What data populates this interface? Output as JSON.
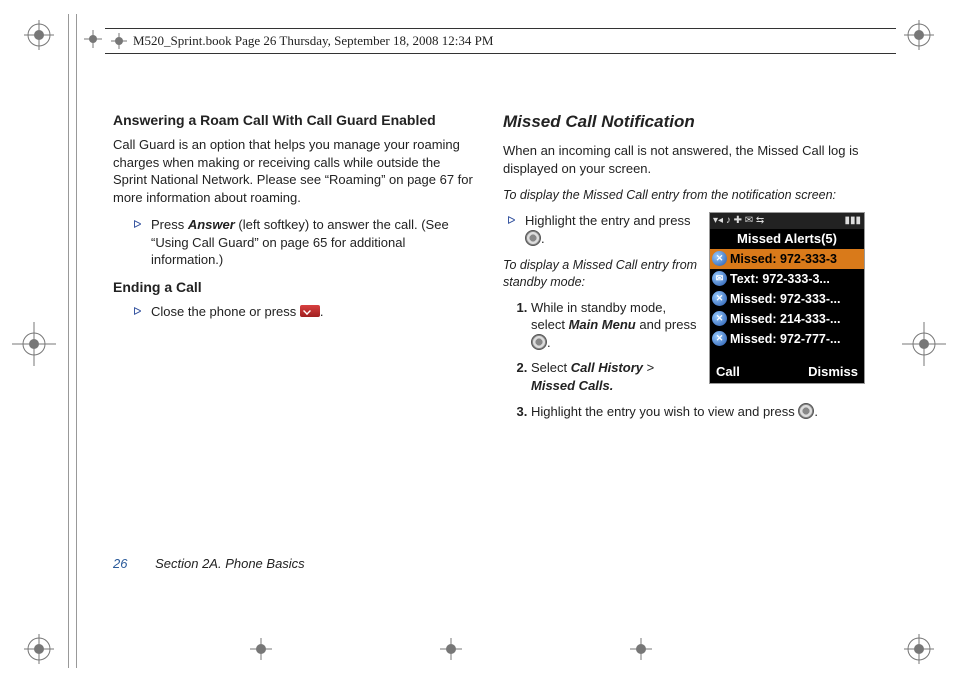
{
  "meta": {
    "header_text": "M520_Sprint.book  Page 26  Thursday, September 18, 2008  12:34 PM"
  },
  "left_col": {
    "h1": "Answering a Roam Call With Call Guard Enabled",
    "p1": "Call Guard is an option that helps you manage your roaming charges when making or receiving calls while outside the Sprint National Network. Please see “Roaming” on page 67 for more information about roaming.",
    "b1_pre": "Press ",
    "b1_strong": "Answer",
    "b1_post": " (left softkey) to answer the call. (See “Using Call Guard” on page 65 for additional information.)",
    "h2": "Ending a Call",
    "b2_pre": "Close the phone or press ",
    "b2_post": "."
  },
  "right_col": {
    "title": "Missed Call Notification",
    "p1": "When an incoming call is not answered, the Missed Call log is displayed on your screen.",
    "lead1": "To display the Missed Call entry from the notification screen:",
    "b1_pre": "Highlight the entry and press ",
    "b1_post": ".",
    "lead2": "To display a Missed Call entry from standby mode:",
    "s1_pre": "While in standby mode, select ",
    "s1_strong": "Main Menu",
    "s1_mid": " and press ",
    "s1_post": ".",
    "s2_pre": "Select ",
    "s2_strong1": "Call History",
    "s2_sep": " > ",
    "s2_strong2": "Missed Calls.",
    "s3_pre": "Highlight the entry you wish to view and press ",
    "s3_post": "."
  },
  "phone": {
    "status_left": "▾◂ ♪  ✚ ✉ ⇆",
    "status_right": "▮▮▮",
    "title": "Missed Alerts(5)",
    "rows": [
      {
        "icon": "✕",
        "text": "Missed: 972-333-3",
        "sel": true
      },
      {
        "icon": "✉",
        "text": "Text: 972-333-3...",
        "sel": false
      },
      {
        "icon": "✕",
        "text": "Missed: 972-333-...",
        "sel": false
      },
      {
        "icon": "✕",
        "text": "Missed: 214-333-...",
        "sel": false
      },
      {
        "icon": "✕",
        "text": "Missed: 972-777-...",
        "sel": false
      }
    ],
    "soft_left": "Call",
    "soft_right": "Dismiss"
  },
  "footer": {
    "page": "26",
    "section": "Section 2A. Phone Basics"
  }
}
